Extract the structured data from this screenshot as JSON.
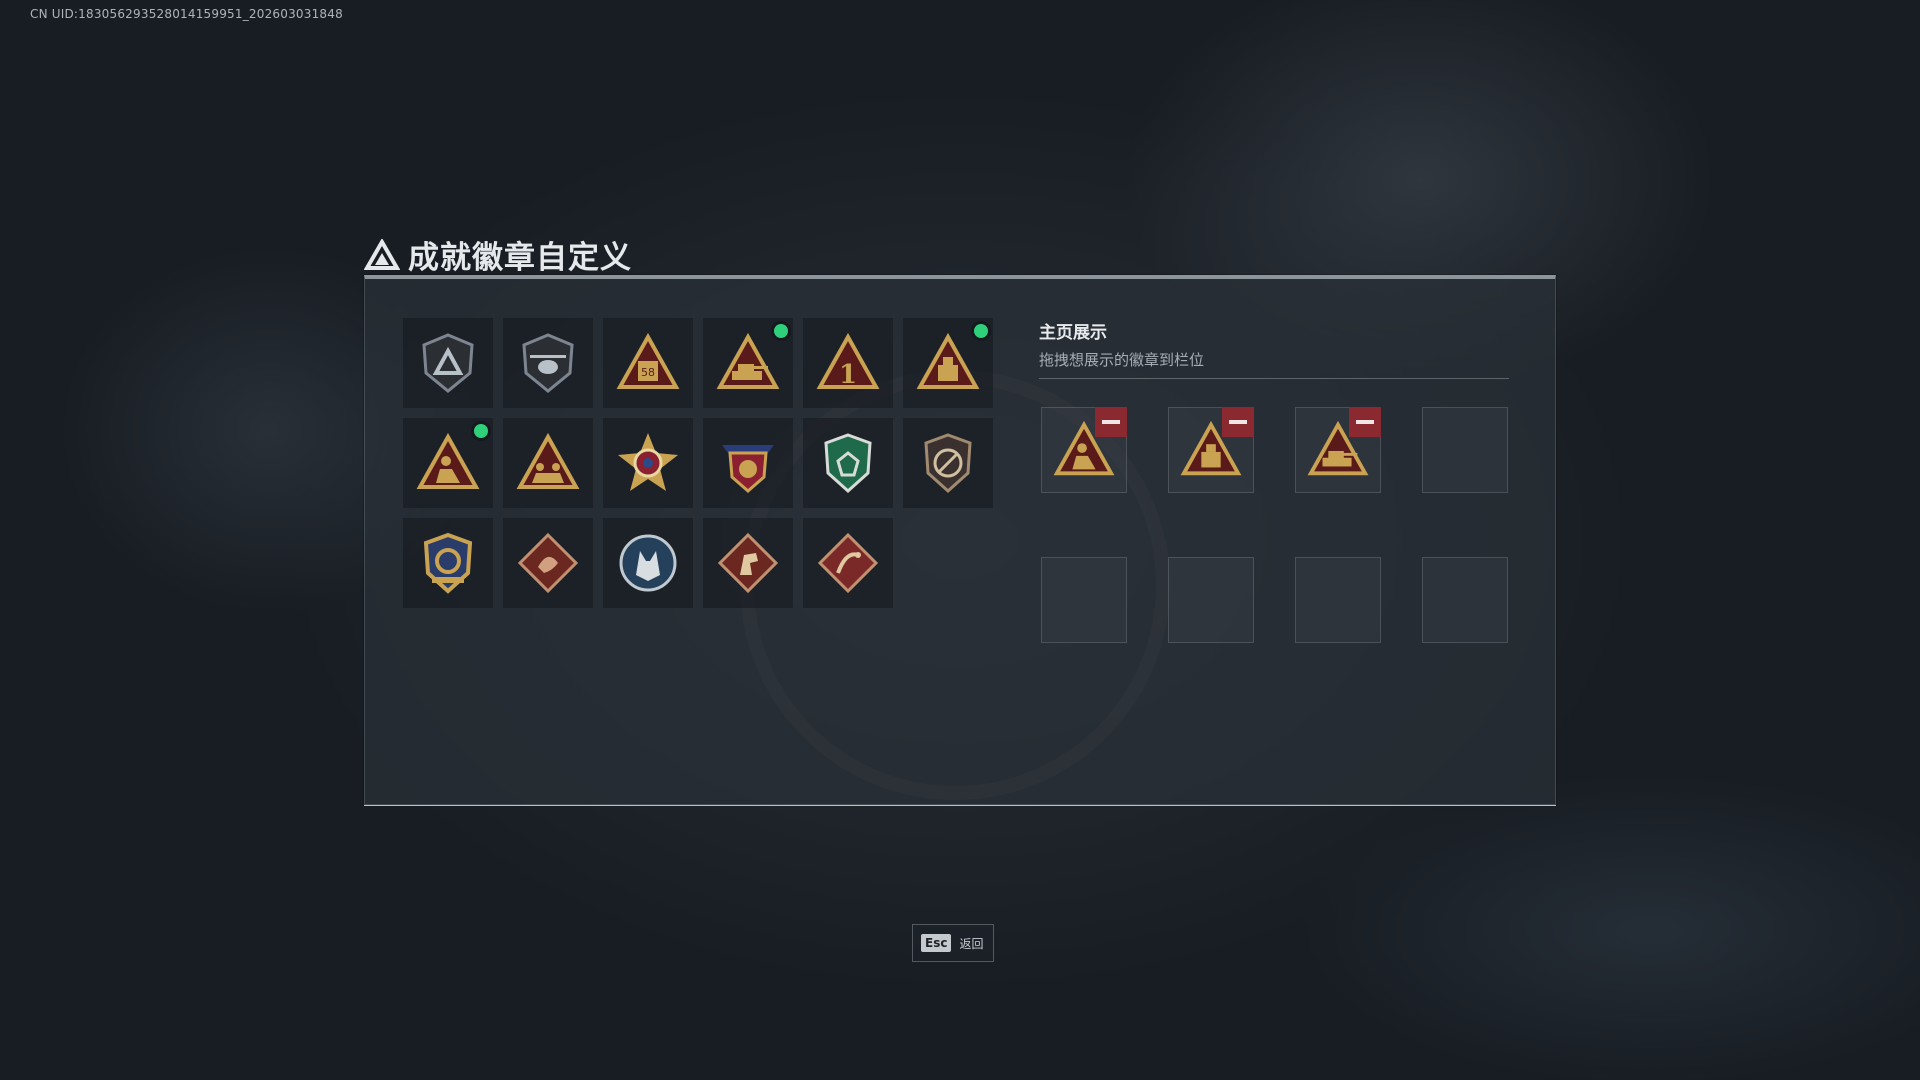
{
  "uid_text": "CN UID:183056293528014159951_202603031848",
  "header": {
    "title": "成就徽章自定义"
  },
  "badges": [
    {
      "icon": "hex-shield-triangle-icon",
      "new": false
    },
    {
      "icon": "helicopter-shield-icon",
      "new": false
    },
    {
      "icon": "triangle-58-icon",
      "new": false
    },
    {
      "icon": "triangle-tank-icon",
      "new": true
    },
    {
      "icon": "triangle-number-one-icon",
      "new": false
    },
    {
      "icon": "triangle-crate-icon",
      "new": true
    },
    {
      "icon": "triangle-soldier-icon",
      "new": true
    },
    {
      "icon": "triangle-squad-icon",
      "new": false
    },
    {
      "icon": "star-compass-icon",
      "new": false
    },
    {
      "icon": "eagle-crest-icon",
      "new": false
    },
    {
      "icon": "green-shield-icon",
      "new": false
    },
    {
      "icon": "no-weapon-shield-icon",
      "new": false
    },
    {
      "icon": "gold-crest-icon",
      "new": false
    },
    {
      "icon": "dragon-diamond-icon",
      "new": false
    },
    {
      "icon": "wolf-circle-icon",
      "new": false
    },
    {
      "icon": "horse-diamond-icon",
      "new": false
    },
    {
      "icon": "scorpion-diamond-icon",
      "new": false
    }
  ],
  "showcase": {
    "title": "主页展示",
    "subtitle": "拖拽想展示的徽章到栏位",
    "slots": [
      {
        "filled": true,
        "icon": "triangle-soldier-icon"
      },
      {
        "filled": true,
        "icon": "triangle-crate-icon"
      },
      {
        "filled": true,
        "icon": "triangle-tank-icon"
      },
      {
        "filled": false
      },
      {
        "filled": false
      },
      {
        "filled": false
      },
      {
        "filled": false
      },
      {
        "filled": false
      }
    ]
  },
  "footer": {
    "esc_key": "Esc",
    "back_label": "返回"
  },
  "colors": {
    "new_dot": "#2fd07a",
    "remove": "#8a2a30",
    "gold": "#c9a352",
    "dark_red": "#5a1a1a"
  }
}
